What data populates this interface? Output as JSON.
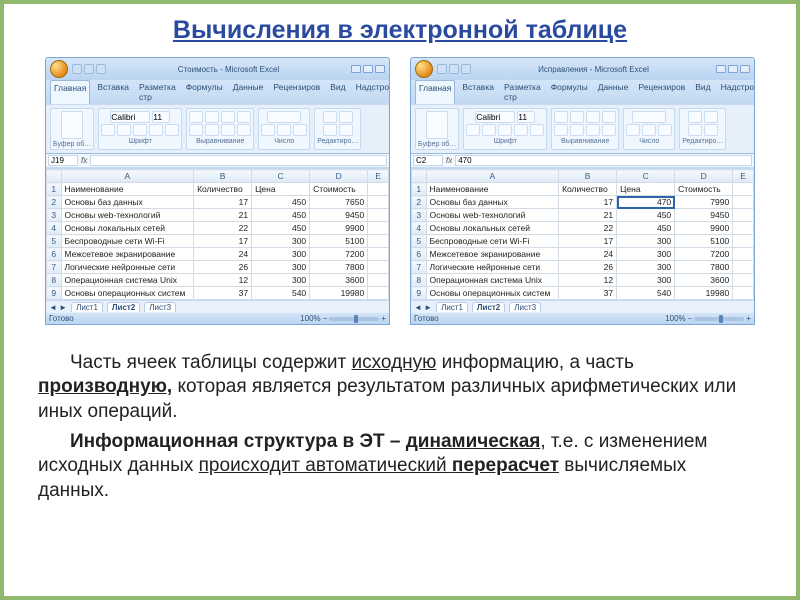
{
  "title": "Вычисления в электронной таблице",
  "excel": {
    "ribbon_tabs": [
      "Главная",
      "Вставка",
      "Разметка стр",
      "Формулы",
      "Данные",
      "Рецензиров",
      "Вид",
      "Надстройки"
    ],
    "ribbon_groups": [
      "Буфер об…",
      "Шрифт",
      "Выравнивание",
      "Число",
      "Редактиро…"
    ],
    "font_name": "Calibri",
    "font_size": "11",
    "sheet_tabs": [
      "Лист1",
      "Лист2",
      "Лист3"
    ],
    "status": "Готово",
    "zoom": "100%",
    "cols": [
      "A",
      "B",
      "C",
      "D",
      "E"
    ],
    "headers": {
      "name": "Наименование",
      "qty": "Количество",
      "price": "Цена",
      "cost": "Стоимость"
    }
  },
  "shot_left": {
    "window_title": "Стоимость - Microsoft Excel",
    "cell_ref": "J19",
    "cell_val": "",
    "rows": [
      {
        "name": "Основы баз данных",
        "qty": 17,
        "price": 450,
        "cost": 7650
      },
      {
        "name": "Основы web-технологий",
        "qty": 21,
        "price": 450,
        "cost": 9450
      },
      {
        "name": "Основы локальных сетей",
        "qty": 22,
        "price": 450,
        "cost": 9900
      },
      {
        "name": "Беспроводные сети Wi-Fi",
        "qty": 17,
        "price": 300,
        "cost": 5100
      },
      {
        "name": "Межсетевое экранирование",
        "qty": 24,
        "price": 300,
        "cost": 7200
      },
      {
        "name": "Логические нейронные сети",
        "qty": 26,
        "price": 300,
        "cost": 7800
      },
      {
        "name": "Операционная система Unix",
        "qty": 12,
        "price": 300,
        "cost": 3600
      },
      {
        "name": "Основы операционных систем",
        "qty": 37,
        "price": 540,
        "cost": 19980
      }
    ]
  },
  "shot_right": {
    "window_title": "Исправления - Microsoft Excel",
    "cell_ref": "C2",
    "cell_val": "470",
    "selected": {
      "row": 0,
      "col": "price"
    },
    "rows": [
      {
        "name": "Основы баз данных",
        "qty": 17,
        "price": 470,
        "cost": 7990
      },
      {
        "name": "Основы web-технологий",
        "qty": 21,
        "price": 450,
        "cost": 9450
      },
      {
        "name": "Основы локальных сетей",
        "qty": 22,
        "price": 450,
        "cost": 9900
      },
      {
        "name": "Беспроводные сети Wi-Fi",
        "qty": 17,
        "price": 300,
        "cost": 5100
      },
      {
        "name": "Межсетевое экранирование",
        "qty": 24,
        "price": 300,
        "cost": 7200
      },
      {
        "name": "Логические нейронные сети",
        "qty": 26,
        "price": 300,
        "cost": 7800
      },
      {
        "name": "Операционная система Unix",
        "qty": 12,
        "price": 300,
        "cost": 3600
      },
      {
        "name": "Основы операционных систем",
        "qty": 37,
        "price": 540,
        "cost": 19980
      }
    ]
  },
  "para1": {
    "indent": "       ",
    "t1": "Часть ячеек таблицы содержит ",
    "u1": "исходную",
    "t2": " информацию, а часть ",
    "bu1": "производную,",
    "t3": " которая является результатом различных арифметических или иных операций."
  },
  "para2": {
    "b1": "Информационная структура в ЭТ – ",
    "bu1": "динамическая",
    "t1": ", т.е. с изменением исходных данных ",
    "u1": "происходит автоматический ",
    "bu2": "перерасчет",
    "t2": " вычисляемых данных."
  }
}
